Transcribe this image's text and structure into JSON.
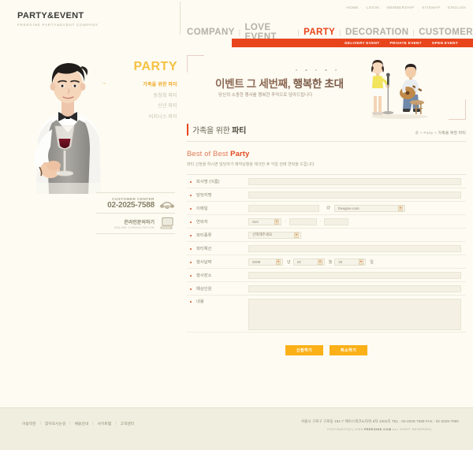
{
  "logo": {
    "title": "PARTY&EVENT",
    "subtitle": "FREEGINE PARTY&EVENT COMPANY"
  },
  "utility_nav": [
    {
      "label": "HOME"
    },
    {
      "label": "LOGIN"
    },
    {
      "label": "MEMBERSHIP"
    },
    {
      "label": "SITEMAP"
    },
    {
      "label": "ENGLISH"
    }
  ],
  "main_nav": {
    "items": [
      {
        "label": "COMPANY",
        "active": false
      },
      {
        "label": "LOVE EVENT",
        "active": false
      },
      {
        "label": "PARTY",
        "active": true
      },
      {
        "label": "DECORATION",
        "active": false
      },
      {
        "label": "CUSTOMER",
        "active": false
      }
    ],
    "separator": "|",
    "active_color": "#e8431b",
    "inactive_color": "#b5b1a6"
  },
  "sub_nav": {
    "background": "#e8451d",
    "items": [
      {
        "label": "DELIVERY EVENT"
      },
      {
        "label": "PRIVATE EVENT"
      },
      {
        "label": "OPEN EVENT"
      }
    ]
  },
  "sidebar": {
    "title": "PARTY",
    "title_color": "#f5c242",
    "items": [
      {
        "label": "가족을 위한 파티",
        "active": true
      },
      {
        "label": "동창회 파티",
        "active": false
      },
      {
        "label": "신년 파티",
        "active": false
      },
      {
        "label": "비지니스 파티",
        "active": false
      }
    ]
  },
  "customer_center": {
    "label": "CUSTOMER CENTER",
    "phone": "02-2025-7588",
    "consult_ko": "온라인문의하기",
    "consult_en": "ONLINE CONSULTATION"
  },
  "banner": {
    "heading_plain": "이벤트 그 세번째,",
    "heading_accent": "행복한 초대",
    "subtitle": "당신의 소중한 행사를 행복한 추억으로 담아드립니다"
  },
  "page": {
    "title_plain": "가족을 위한 ",
    "title_bold": "파티",
    "breadcrumb_home": "홈",
    "breadcrumb_section": "Party",
    "breadcrumb_current": "가족을 위한 파티"
  },
  "form": {
    "heading_plain": "Best of Best ",
    "heading_bold": "Party",
    "description": "파티 신청을 하시면 담당자가 예약상황을 체크한 후 익일 안에 연락을 드립니다",
    "fields": {
      "company": {
        "label": "회사명 (이름)",
        "value": ""
      },
      "manager": {
        "label": "담당자명",
        "value": ""
      },
      "email": {
        "label": "이메일",
        "user_value": "",
        "at": "@",
        "domain_value": "freegine.com"
      },
      "phone": {
        "label": "연락처",
        "prefix_value": "010",
        "mid_value": "",
        "last_value": "",
        "dash": "-"
      },
      "party_type": {
        "label": "파티종류",
        "value": "선택해주세요"
      },
      "budget": {
        "label": "파티예산",
        "value": ""
      },
      "event_date": {
        "label": "행사날짜",
        "year_value": "2008",
        "year_unit": "년",
        "month_value": "10",
        "month_unit": "월",
        "day_value": "20",
        "day_unit": "일"
      },
      "venue": {
        "label": "행사장소",
        "value": ""
      },
      "attendees": {
        "label": "예상인원",
        "value": ""
      },
      "content": {
        "label": "내용",
        "value": ""
      }
    },
    "buttons": {
      "submit": "신청하기",
      "cancel": "취소하기",
      "color": "#fbb018"
    }
  },
  "footer": {
    "links": [
      {
        "label": "이용약관"
      },
      {
        "label": "찾아오시는길"
      },
      {
        "label": "채용안내"
      },
      {
        "label": "사이트맵"
      },
      {
        "label": "고객센터"
      }
    ],
    "address": "서울시 구로구 구로동 191-7 에이스테크노타워 8차 1002호  TEL : 02-2025-7588  FAX : 02-2025-7590",
    "copyright_pre": "COPYRIGHT(C) 2008 ",
    "copyright_brand": "FREEGINE.COM",
    "copyright_post": " ALL RIGHT RESERVED."
  }
}
